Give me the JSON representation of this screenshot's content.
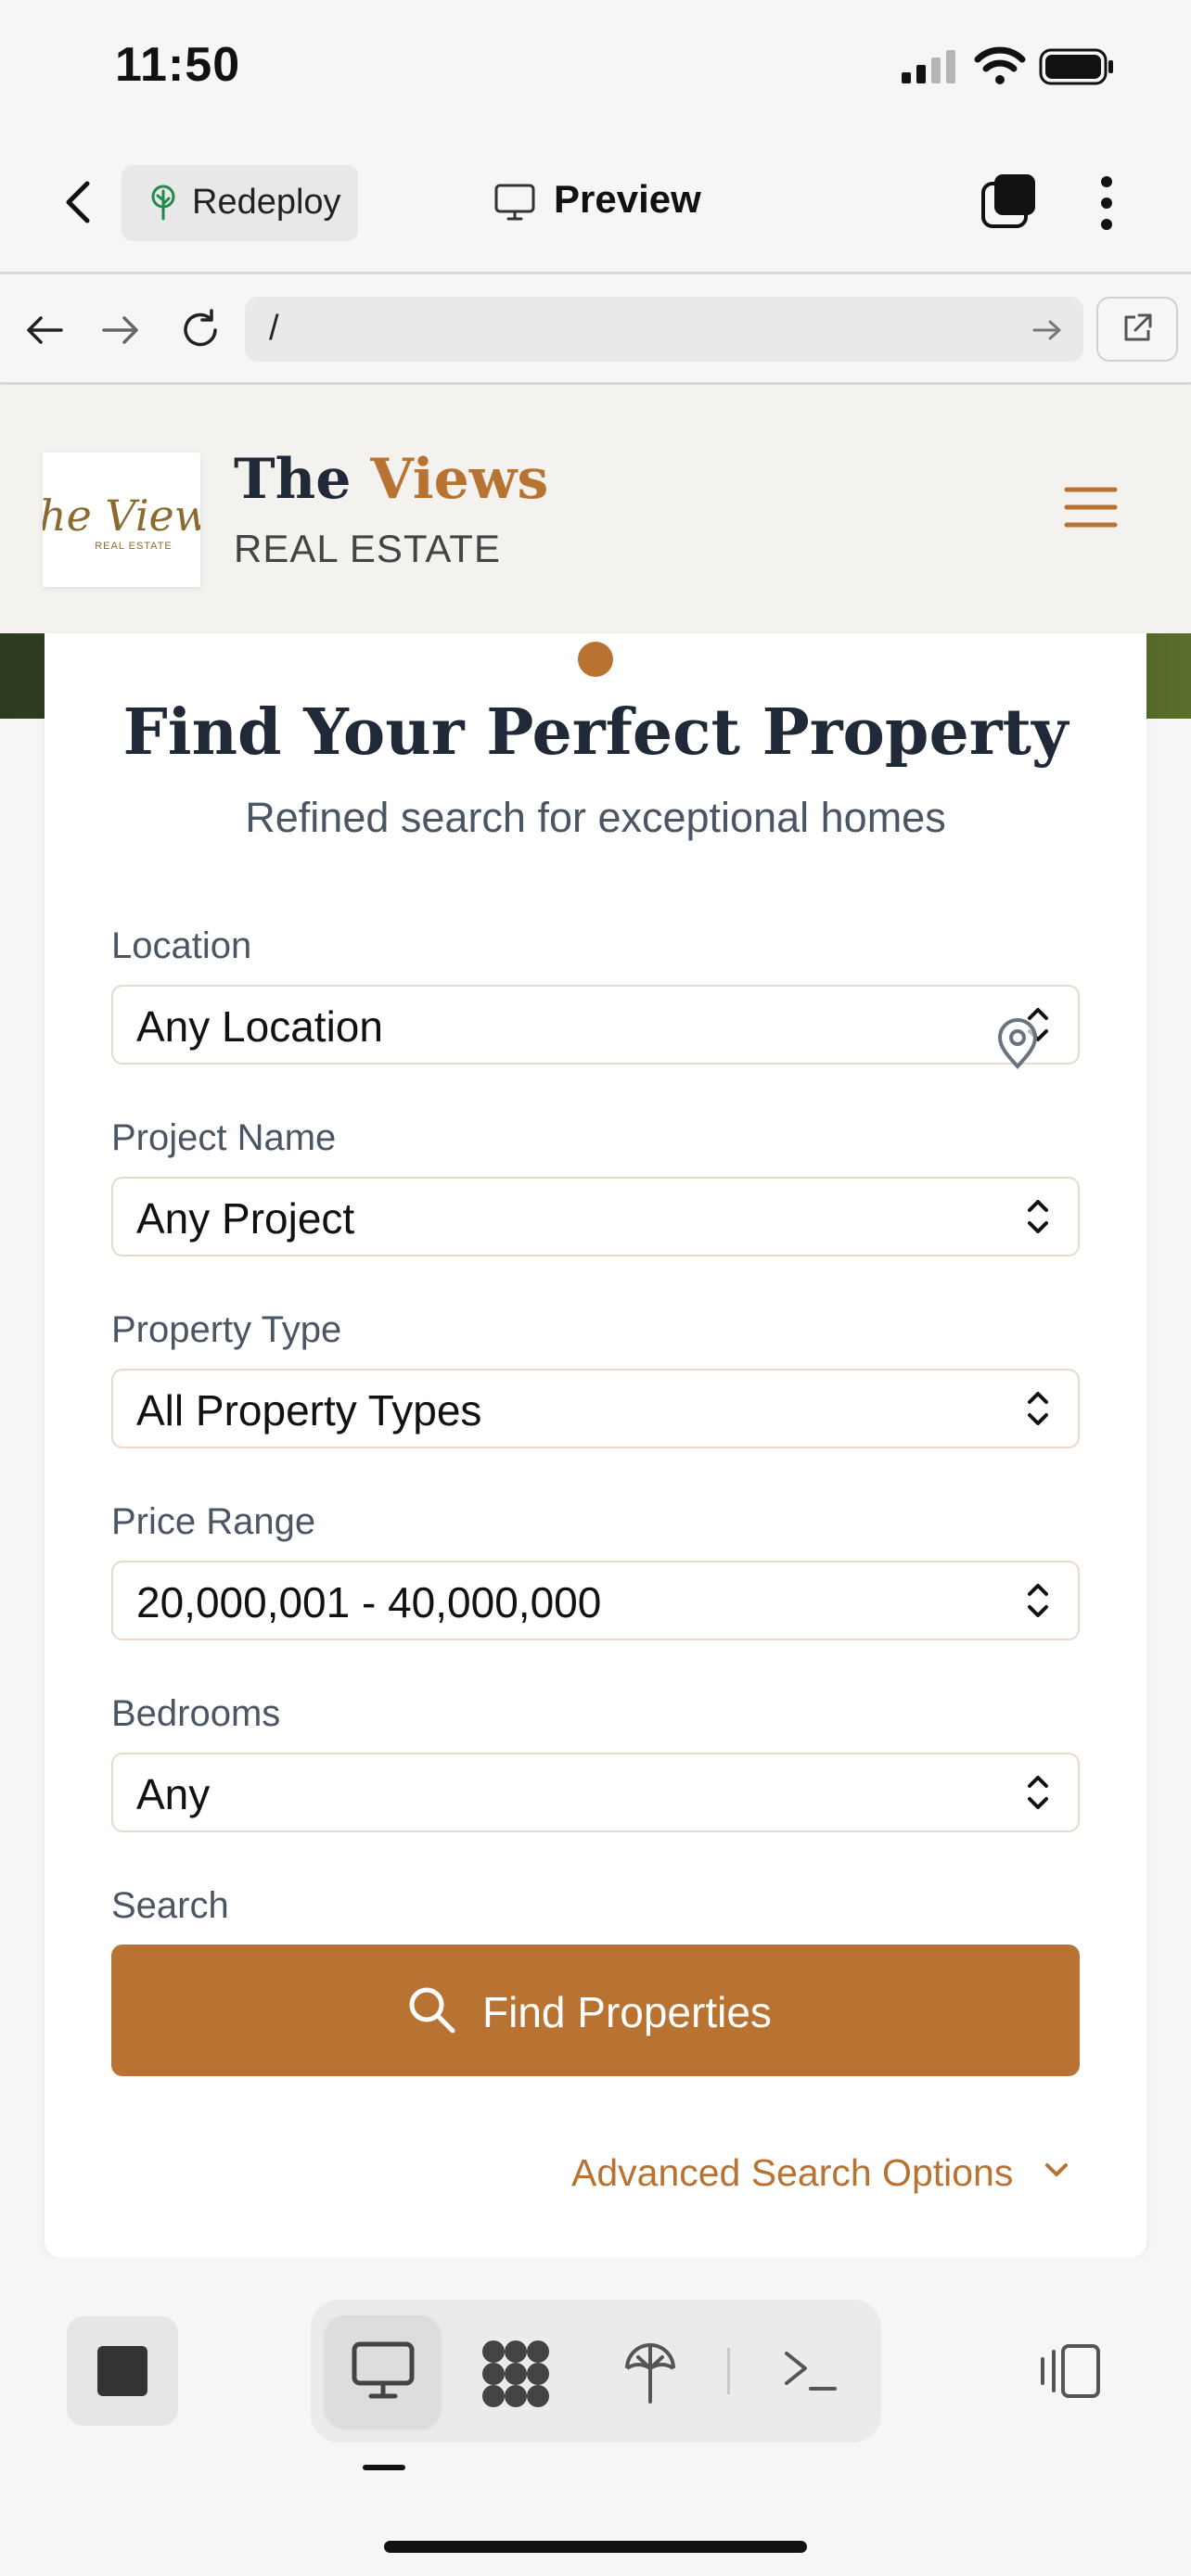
{
  "status_bar": {
    "time": "11:50"
  },
  "app_bar": {
    "redeploy_label": "Redeploy",
    "preview_label": "Preview"
  },
  "browser": {
    "url": "/"
  },
  "site_header": {
    "brand_word1": "The",
    "brand_word2": "Views",
    "brand_sub": "REAL ESTATE",
    "logo_text": "The Views",
    "logo_sub": "REAL ESTATE"
  },
  "search": {
    "title": "Find Your Perfect Property",
    "subtitle": "Refined search for exceptional homes",
    "fields": [
      {
        "label": "Location",
        "value": "Any Location"
      },
      {
        "label": "Project Name",
        "value": "Any Project"
      },
      {
        "label": "Property Type",
        "value": "All Property Types"
      },
      {
        "label": "Price Range",
        "value": "20,000,001 - 40,000,000"
      },
      {
        "label": "Bedrooms",
        "value": "Any"
      }
    ],
    "search_label": "Search",
    "button_label": "Find Properties",
    "advanced_label": "Advanced Search Options"
  },
  "colors": {
    "accent": "#b87333",
    "heading": "#1f2937",
    "muted": "#4b5563",
    "field_border": "#ead8c8"
  },
  "icons": {
    "back": "chevron-left-icon",
    "redeploy": "tree-icon",
    "preview": "monitor-icon",
    "tabs": "tabs-icon",
    "more": "more-vertical-icon",
    "nav_back": "arrow-left-icon",
    "nav_forward": "arrow-right-icon",
    "reload": "reload-icon",
    "go": "arrow-right-icon",
    "external": "external-link-icon",
    "menu": "hamburger-icon",
    "location": "map-pin-icon",
    "select": "chevron-up-down-icon",
    "search": "search-icon",
    "advanced": "chevron-down-icon"
  }
}
